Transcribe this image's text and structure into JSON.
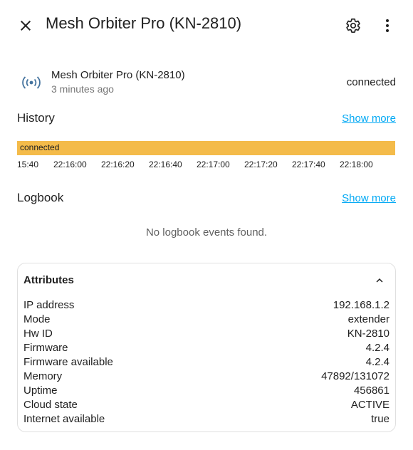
{
  "header": {
    "title": "Mesh Orbiter Pro (KN-2810)",
    "close_icon": "close-icon",
    "settings_icon": "gear-icon",
    "menu_icon": "more-vertical-icon"
  },
  "entity": {
    "icon": "broadcast-icon",
    "name": "Mesh Orbiter Pro (KN-2810)",
    "last_changed": "3 minutes ago",
    "state": "connected"
  },
  "history": {
    "title": "History",
    "show_more": "Show more",
    "timeline_state": "connected",
    "timeline_color": "#f4bb4a",
    "ticks": [
      "15:40",
      "22:16:00",
      "22:16:20",
      "22:16:40",
      "22:17:00",
      "22:17:20",
      "22:17:40",
      "22:18:00"
    ]
  },
  "logbook": {
    "title": "Logbook",
    "show_more": "Show more",
    "empty_text": "No logbook events found."
  },
  "attributes": {
    "title": "Attributes",
    "chevron_icon": "chevron-up-icon",
    "rows": [
      {
        "key": "IP address",
        "value": "192.168.1.2"
      },
      {
        "key": "Mode",
        "value": "extender"
      },
      {
        "key": "Hw ID",
        "value": "KN-2810"
      },
      {
        "key": "Firmware",
        "value": "4.2.4"
      },
      {
        "key": "Firmware available",
        "value": "4.2.4"
      },
      {
        "key": "Memory",
        "value": "47892/131072"
      },
      {
        "key": "Uptime",
        "value": "456861"
      },
      {
        "key": "Cloud state",
        "value": "ACTIVE"
      },
      {
        "key": "Internet available",
        "value": "true"
      }
    ]
  },
  "colors": {
    "accent_link": "#03a9f4",
    "entity_icon": "#44739e",
    "history_bar": "#f4bb4a"
  }
}
